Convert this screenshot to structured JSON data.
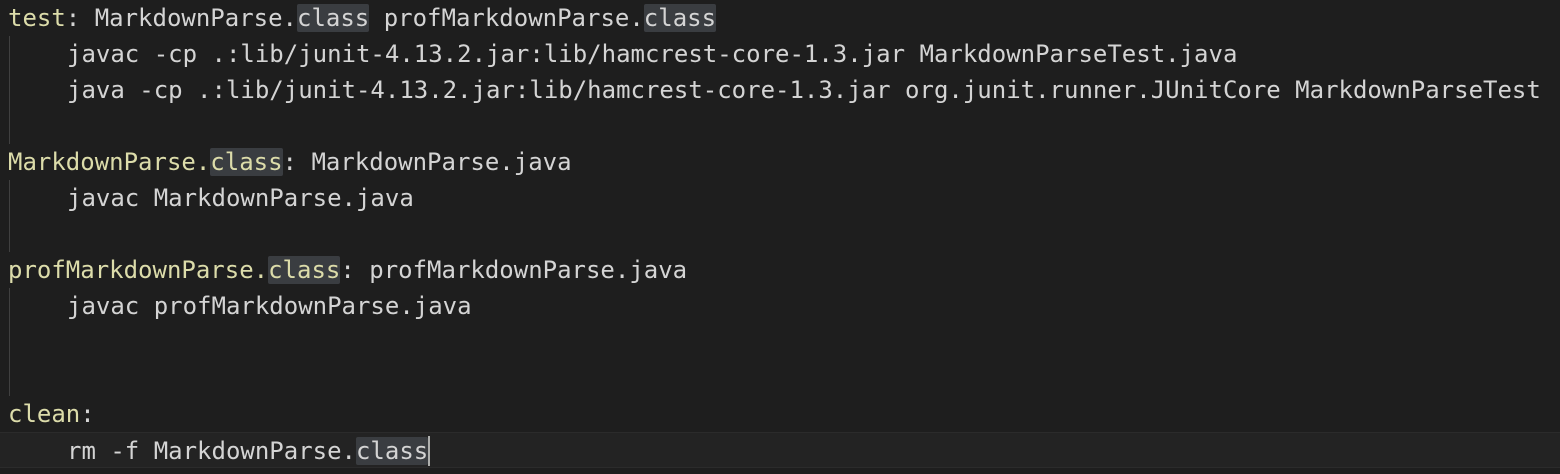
{
  "editor": {
    "colors": {
      "background": "#1e1e1e",
      "text": "#d4d4d4",
      "target": "#dcdcaa",
      "highlight": "#3a3d41"
    },
    "lines": [
      {
        "target": "test",
        "sep": ":",
        "deps_a": " MarkdownParse.",
        "hl_a": "class",
        "deps_b": " profMarkdownParse.",
        "hl_b": "class"
      },
      {
        "text": "javac -cp .:lib/junit-4.13.2.jar:lib/hamcrest-core-1.3.jar MarkdownParseTest.java"
      },
      {
        "text": "java -cp .:lib/junit-4.13.2.jar:lib/hamcrest-core-1.3.jar org.junit.runner.JUnitCore MarkdownParseTest"
      },
      {
        "text": ""
      },
      {
        "target": "MarkdownParse.",
        "hl": "class",
        "sep": ":",
        "deps": " MarkdownParse.java"
      },
      {
        "text": "javac MarkdownParse.java"
      },
      {
        "text": ""
      },
      {
        "target": "profMarkdownParse.",
        "hl": "class",
        "sep": ":",
        "deps": " profMarkdownParse.java"
      },
      {
        "text": "javac profMarkdownParse.java"
      },
      {
        "text": ""
      },
      {
        "text": ""
      },
      {
        "target": "clean",
        "sep": ":"
      },
      {
        "text": "rm -f MarkdownParse.",
        "hl": "class"
      }
    ]
  }
}
